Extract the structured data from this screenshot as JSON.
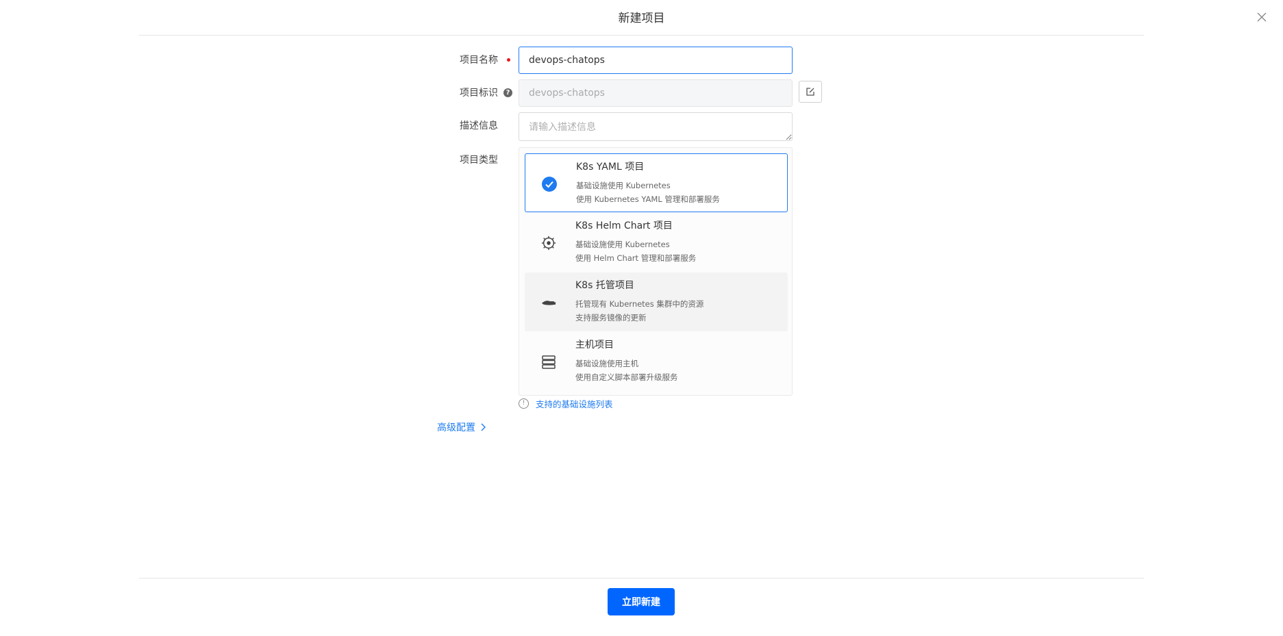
{
  "dialog": {
    "title": "新建项目",
    "close_icon": "close-icon"
  },
  "form": {
    "name": {
      "label": "项目名称",
      "value": "devops-chatops",
      "required_color": "#e5181d"
    },
    "identifier": {
      "label": "项目标识",
      "value": "devops-chatops",
      "help_icon": "question-circle-icon",
      "edit_icon": "edit-icon"
    },
    "description": {
      "label": "描述信息",
      "placeholder": "请输入描述信息"
    },
    "project_type": {
      "label": "项目类型",
      "options": [
        {
          "title": "K8s YAML 项目",
          "line1": "基础设施使用 Kubernetes",
          "line2": "使用 Kubernetes YAML 管理和部署服务",
          "icon": "check-circle-icon",
          "selected": true
        },
        {
          "title": "K8s Helm Chart 项目",
          "line1": "基础设施使用 Kubernetes",
          "line2": "使用 Helm Chart 管理和部署服务",
          "icon": "helm-icon",
          "selected": false
        },
        {
          "title": "K8s 托管项目",
          "line1": "托管现有 Kubernetes 集群中的资源",
          "line2": "支持服务镜像的更新",
          "icon": "hand-icon",
          "selected": false
        },
        {
          "title": "主机项目",
          "line1": "基础设施使用主机",
          "line2": "使用自定义脚本部署升级服务",
          "icon": "server-icon",
          "selected": false
        }
      ]
    },
    "infra_link": "支持的基础设施列表",
    "advanced": "高级配置"
  },
  "footer": {
    "submit": "立即新建"
  },
  "colors": {
    "accent": "#1e7bf0",
    "primary_button": "#0066ff"
  }
}
